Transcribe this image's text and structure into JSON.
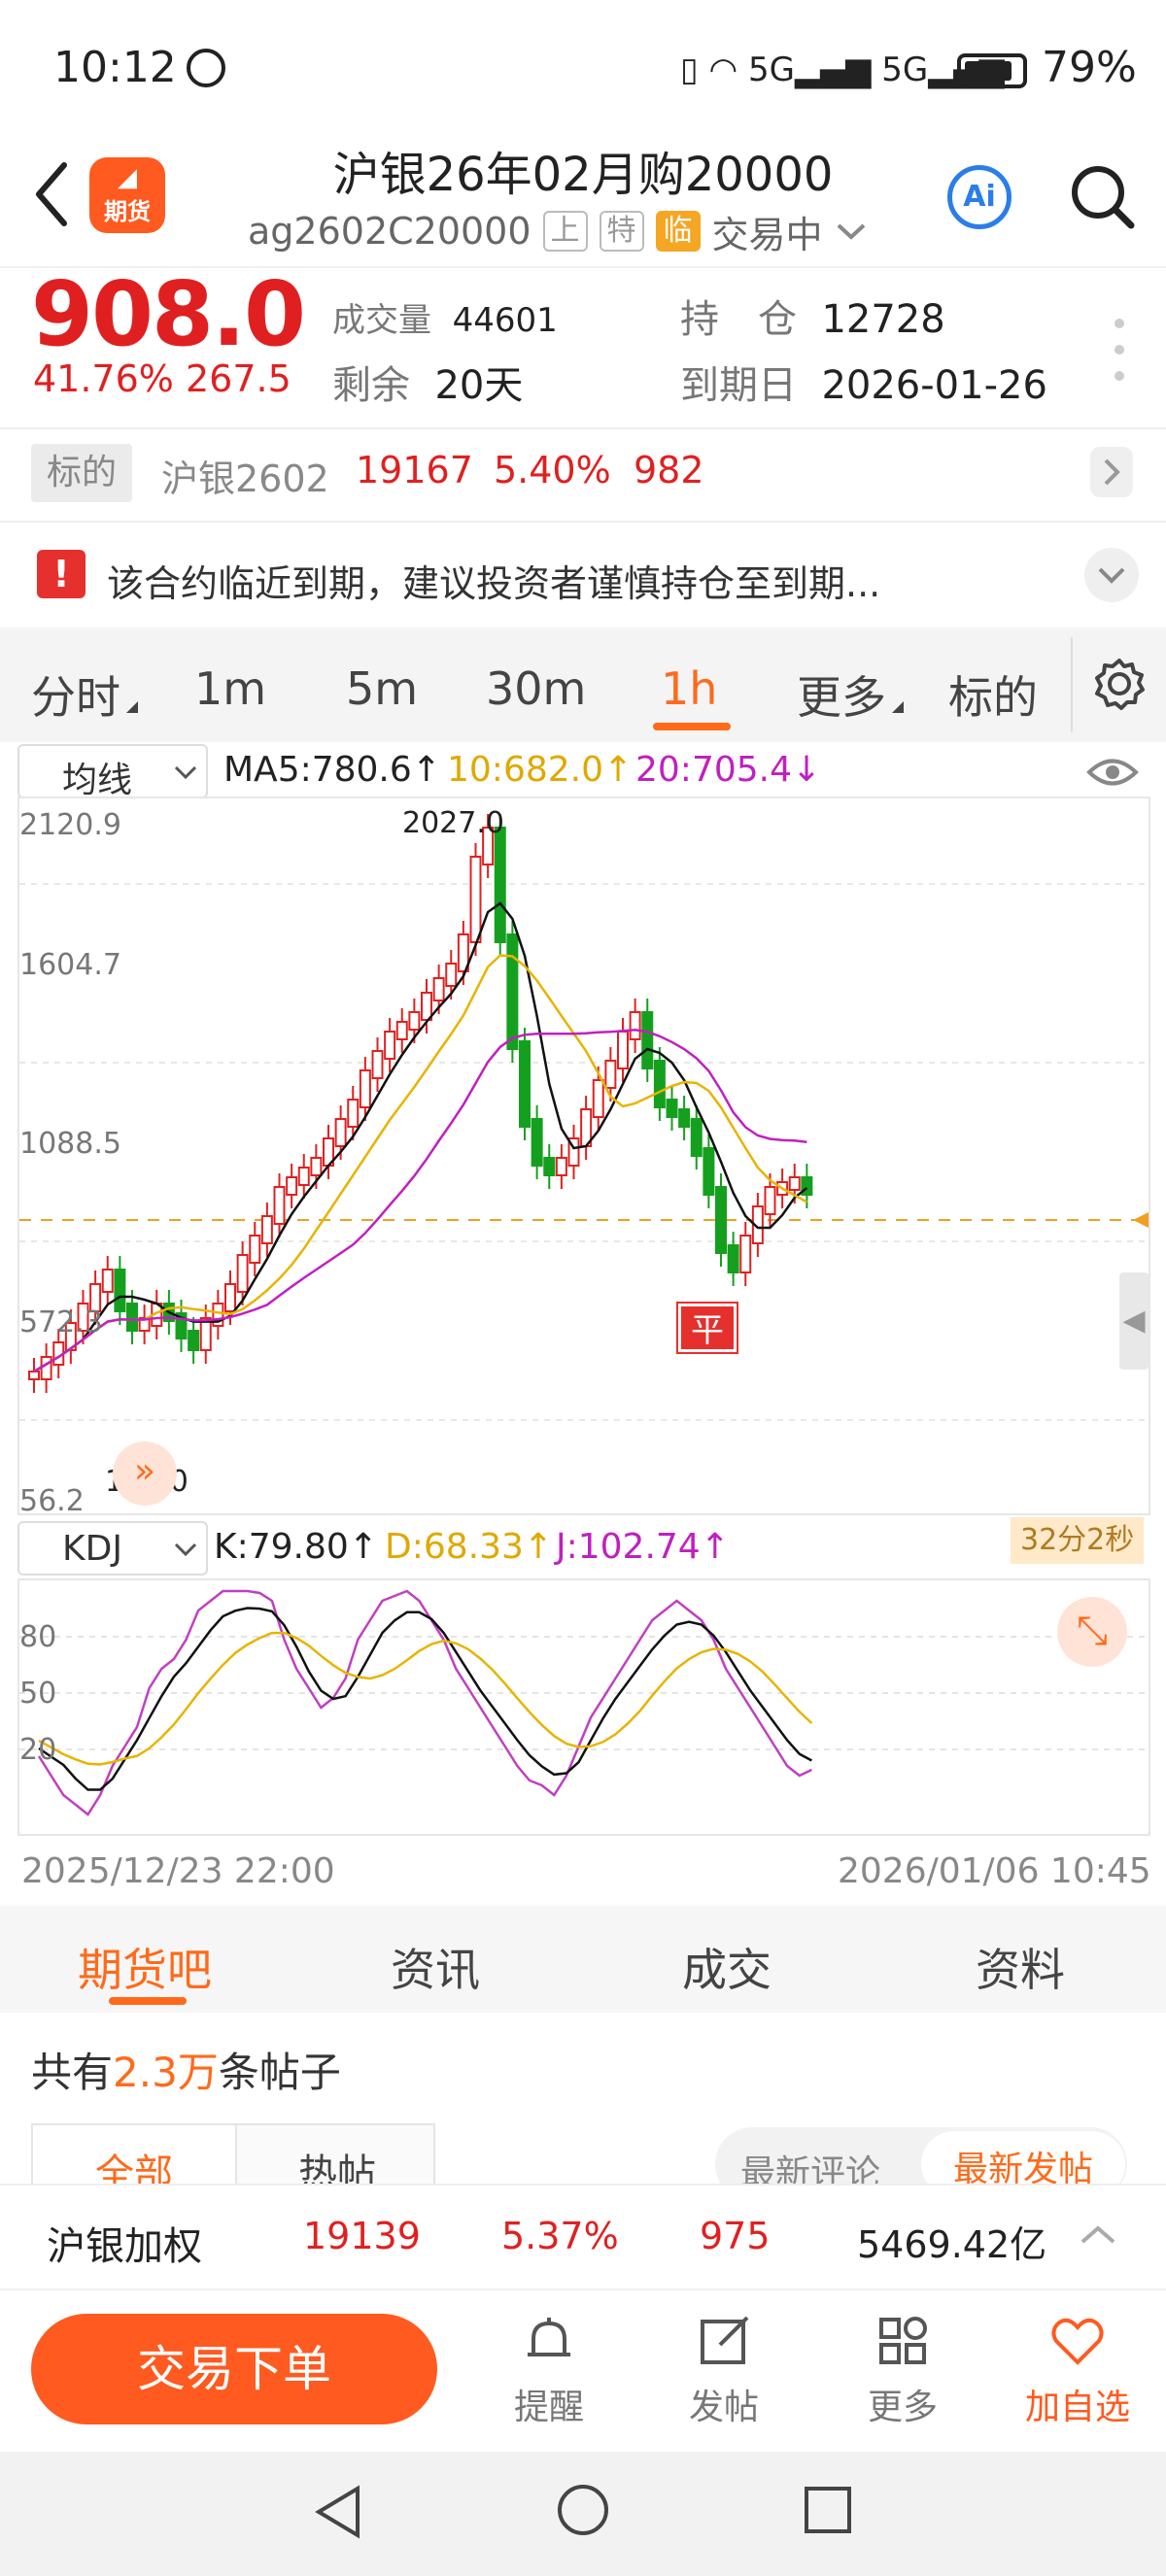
{
  "status_bar": {
    "time": "10:12",
    "right_text": "79%"
  },
  "header": {
    "logo_label": "期货",
    "title": "沪银26年02月购20000",
    "code": "ag2602C20000",
    "tags": [
      "上",
      "特",
      "临"
    ],
    "trade_status": "交易中"
  },
  "quote": {
    "price": "908.0",
    "change_pct": "41.76%",
    "change": "267.5",
    "volume_label": "成交量",
    "volume": "44601",
    "oi_label": "持　仓",
    "oi": "12728",
    "remain_label": "剩余",
    "remain": "20天",
    "expiry_label": "到期日",
    "expiry": "2026-01-26"
  },
  "underlying": {
    "chip": "标的",
    "name": "沪银2602",
    "price": "19167",
    "pct": "5.40%",
    "change": "982"
  },
  "notice": {
    "text": "该合约临近到期，建议投资者谨慎持仓至到期..."
  },
  "period_tabs": [
    "分时",
    "1m",
    "5m",
    "30m",
    "1h",
    "更多",
    "标的"
  ],
  "active_period": "1h",
  "ma_bar": {
    "dropdown": "均线",
    "ma5": "MA5:780.6↑",
    "ma10": "10:682.0↑",
    "ma20": "20:705.4↓"
  },
  "kdj_bar": {
    "dropdown": "KDJ",
    "k": "K:79.80↑",
    "d": "D:68.33↑",
    "j": "J:102.74↑",
    "countdown": "32分2秒"
  },
  "chart_data": {
    "type": "candlestick",
    "interval": "1h",
    "y_ticks": [
      "2120.9",
      "1604.7",
      "1088.5",
      "572.3",
      "56.2"
    ],
    "high_label": "2027.0",
    "low_label": "150.0",
    "position_marker": "平",
    "current_price_line": 908.0,
    "x_start": "2025/12/23 22:00",
    "x_end": "2026/01/06 10:45",
    "kdj_ticks": [
      "80",
      "50",
      "20"
    ],
    "colors": {
      "up": "#e02020",
      "down": "#14a01e",
      "ma5": "#111111",
      "ma10": "#e8b400",
      "ma20": "#c020c0",
      "k": "#111111",
      "d": "#e8b400",
      "j": "#c040c0"
    }
  },
  "section_tabs": [
    "期货吧",
    "资讯",
    "成交",
    "资料"
  ],
  "forum": {
    "count_prefix": "共有",
    "count": "2.3万",
    "count_suffix": "条帖子",
    "filters": [
      "全部",
      "热帖"
    ],
    "sorts": [
      "最新评论",
      "最新发帖"
    ]
  },
  "ticker": {
    "name": "沪银加权",
    "price": "19139",
    "pct": "5.37%",
    "change": "975",
    "amount": "5469.42亿"
  },
  "actions": {
    "trade": "交易下单",
    "items": [
      "提醒",
      "发帖",
      "更多",
      "加自选"
    ]
  }
}
